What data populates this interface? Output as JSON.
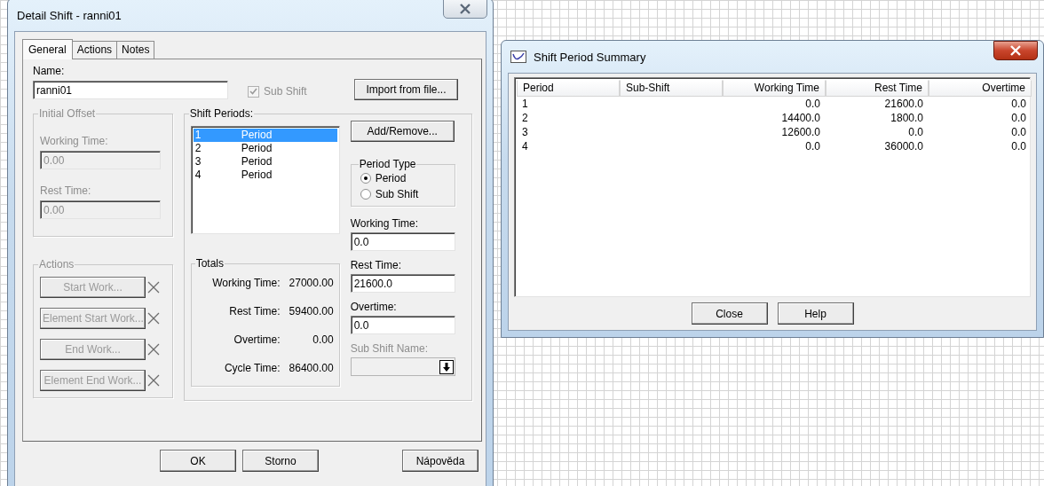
{
  "detail_window": {
    "title": "Detail Shift - ranni01",
    "tabs": [
      {
        "label": "General",
        "selected": true
      },
      {
        "label": "Actions",
        "selected": false
      },
      {
        "label": "Notes",
        "selected": false
      }
    ],
    "name": {
      "label": "Name:",
      "value": "ranni01"
    },
    "sub_shift_checkbox": {
      "label": "Sub Shift",
      "checked": true,
      "disabled": true
    },
    "import_button": "Import from file...",
    "initial_offset": {
      "title": "Initial Offset",
      "disabled": true,
      "fields": [
        {
          "label": "Working Time:",
          "value": "0.00"
        },
        {
          "label": "Rest Time:",
          "value": "0.00"
        }
      ]
    },
    "actions": {
      "title": "Actions",
      "disabled": true,
      "buttons": [
        "Start Work...",
        "Element Start Work...",
        "End Work...",
        "Element End Work..."
      ]
    },
    "shift_periods": {
      "title": "Shift Periods:",
      "items": [
        {
          "number": "1",
          "type": "Period",
          "selected": true
        },
        {
          "number": "2",
          "type": "Period",
          "selected": false
        },
        {
          "number": "3",
          "type": "Period",
          "selected": false
        },
        {
          "number": "4",
          "type": "Period",
          "selected": false
        }
      ],
      "add_remove_button": "Add/Remove...",
      "period_type": {
        "title": "Period Type",
        "options": [
          {
            "label": "Period",
            "selected": true
          },
          {
            "label": "Sub Shift",
            "selected": false
          }
        ]
      },
      "fields": [
        {
          "label": "Working Time:",
          "value": "0.0"
        },
        {
          "label": "Rest Time:",
          "value": "21600.0"
        },
        {
          "label": "Overtime:",
          "value": "0.0"
        }
      ],
      "sub_shift_name": {
        "label": "Sub Shift Name:",
        "disabled": true
      },
      "totals": {
        "title": "Totals",
        "rows": [
          {
            "label": "Working Time:",
            "value": "27000.00"
          },
          {
            "label": "Rest Time:",
            "value": "59400.00"
          },
          {
            "label": "Overtime:",
            "value": "0.00"
          },
          {
            "label": "Cycle Time:",
            "value": "86400.00"
          }
        ]
      }
    },
    "buttons": [
      "OK",
      "Storno",
      "Nápověda"
    ]
  },
  "summary_window": {
    "title": "Shift Period Summary",
    "columns": [
      "Period",
      "Sub-Shift",
      "Working Time",
      "Rest Time",
      "Overtime"
    ],
    "rows": [
      {
        "period": "1",
        "working_time": "0.0",
        "rest_time": "21600.0",
        "overtime": "0.0"
      },
      {
        "period": "2",
        "working_time": "14400.0",
        "rest_time": "1800.0",
        "overtime": "0.0"
      },
      {
        "period": "3",
        "working_time": "12600.0",
        "rest_time": "0.0",
        "overtime": "0.0"
      },
      {
        "period": "4",
        "working_time": "0.0",
        "rest_time": "36000.0",
        "overtime": "0.0"
      }
    ],
    "buttons": [
      "Close",
      "Help"
    ]
  }
}
